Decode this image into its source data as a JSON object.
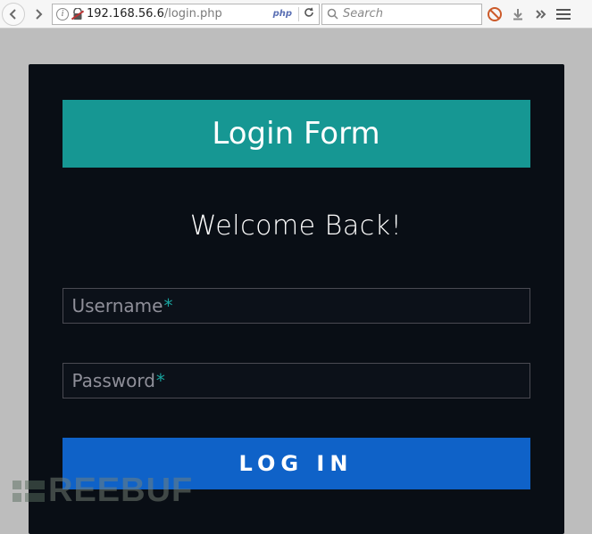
{
  "toolbar": {
    "url_host": "192.168.56.6",
    "url_path": "/login.php",
    "php_badge": "php",
    "search_placeholder": "Search"
  },
  "login": {
    "banner": "Login Form",
    "welcome": "Welcome Back!",
    "username_label": "Username",
    "password_label": "Password",
    "required_mark": "*",
    "submit_label": "LOG IN"
  },
  "watermark": {
    "text": "REEBUF"
  }
}
